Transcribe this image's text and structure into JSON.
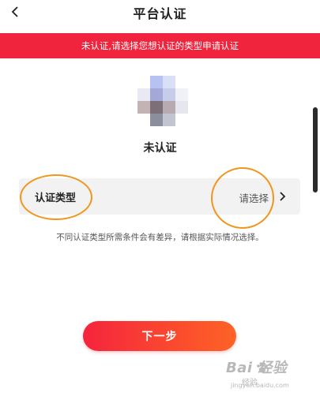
{
  "header": {
    "title": "平台认证",
    "back_icon": "chevron-left-icon"
  },
  "banner": {
    "text": "未认证,请选择您想认证的类型申请认证",
    "color": "#f0243c"
  },
  "profile": {
    "status": "未认证"
  },
  "type_select": {
    "label": "认证类型",
    "value": "请选择",
    "chevron_icon": "chevron-right-icon"
  },
  "hint": "不同认证类型所需条件会有差异，请根据实际情况选择。",
  "next_button": {
    "label": "下一步"
  },
  "watermark": {
    "brand": "Bai  经验",
    "sub": "经验",
    "url": "jingyan.baidu.com"
  },
  "colors": {
    "accent": "#f0243c",
    "annotation": "#f0961e"
  }
}
